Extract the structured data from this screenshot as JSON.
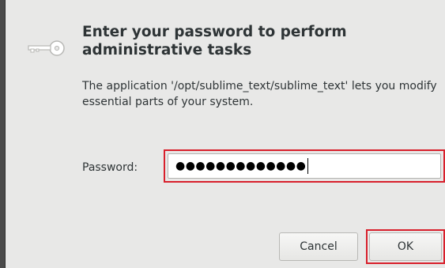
{
  "dialog": {
    "icon": "key-icon",
    "title": "Enter your password to perform administrative tasks",
    "description": "The application '/opt/sublime_text/sublime_text' lets you modify essential parts of your system.",
    "password_label": "Password:",
    "password_value": "●●●●●●●●●●●●●",
    "cancel_label": "Cancel",
    "ok_label": "OK"
  },
  "colors": {
    "highlight": "#d8202c",
    "dialog_background": "#e8e8e7",
    "text": "#2e3436"
  }
}
